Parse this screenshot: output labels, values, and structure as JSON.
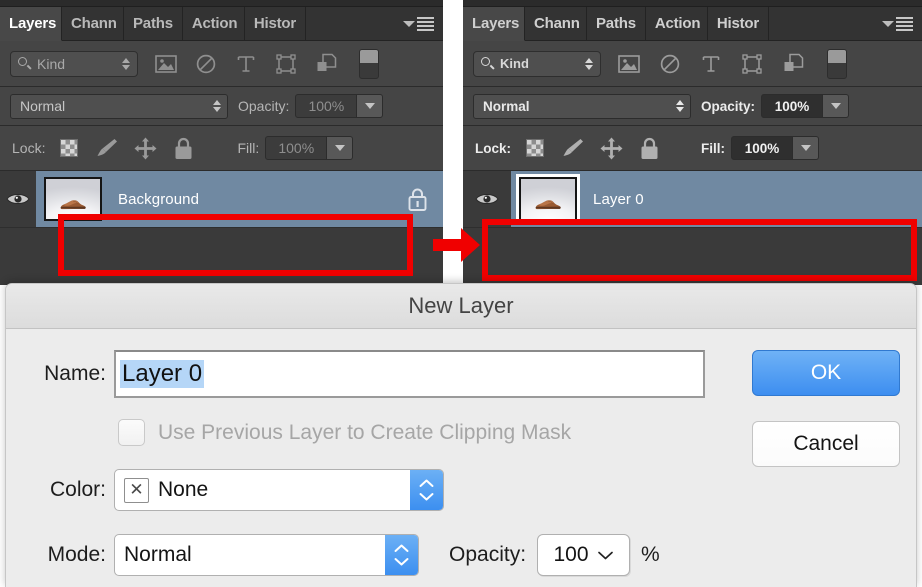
{
  "panels": {
    "before": {
      "id": "before-panel",
      "tabs": [
        {
          "label": "Layers",
          "active": true
        },
        {
          "label": "Chann",
          "active": false
        },
        {
          "label": "Paths",
          "active": false
        },
        {
          "label": "Action",
          "active": false
        },
        {
          "label": "Histor",
          "active": false
        }
      ],
      "menu_icon": "panel-menu-icon",
      "filter": {
        "kind_label": "Kind",
        "search_icon": "search-icon",
        "icons": [
          "image-filter-icon",
          "adjustment-filter-icon",
          "type-filter-icon",
          "shape-filter-icon",
          "smart-object-filter-icon",
          "filter-toggle-switch"
        ]
      },
      "blend": {
        "mode": "Normal",
        "opacity_label": "Opacity:",
        "opacity_value": "100%"
      },
      "lock": {
        "label": "Lock:",
        "icons": [
          "lock-transparent-pixels-icon",
          "lock-image-pixels-icon",
          "lock-position-icon",
          "lock-all-icon"
        ],
        "fill_label": "Fill:",
        "fill_value": "100%"
      },
      "layer": {
        "name": "Background",
        "visible": true,
        "locked": true,
        "thumbnail": "shoe-thumbnail",
        "selected": true
      }
    },
    "after": {
      "id": "after-panel",
      "tabs": [
        {
          "label": "Layers",
          "active": true
        },
        {
          "label": "Chann",
          "active": false
        },
        {
          "label": "Paths",
          "active": false
        },
        {
          "label": "Action",
          "active": false
        },
        {
          "label": "Histor",
          "active": false
        }
      ],
      "menu_icon": "panel-menu-icon",
      "filter": {
        "kind_label": "Kind",
        "search_icon": "search-icon",
        "icons": [
          "image-filter-icon",
          "adjustment-filter-icon",
          "type-filter-icon",
          "shape-filter-icon",
          "smart-object-filter-icon",
          "filter-toggle-switch"
        ]
      },
      "blend": {
        "mode": "Normal",
        "opacity_label": "Opacity:",
        "opacity_value": "100%"
      },
      "lock": {
        "label": "Lock:",
        "icons": [
          "lock-transparent-pixels-icon",
          "lock-image-pixels-icon",
          "lock-position-icon",
          "lock-all-icon"
        ],
        "fill_label": "Fill:",
        "fill_value": "100%"
      },
      "layer": {
        "name": "Layer 0",
        "visible": true,
        "locked": false,
        "thumbnail": "shoe-thumbnail",
        "selected": true
      }
    }
  },
  "annotation": {
    "arrow_icon": "red-right-arrow",
    "highlight_color": "#f00000"
  },
  "dialog": {
    "title": "New Layer",
    "name_label": "Name:",
    "name_value": "Layer 0",
    "clipping_label": "Use Previous Layer to Create Clipping Mask",
    "clipping_checked": false,
    "color_label": "Color:",
    "color_value": "None",
    "color_swatch_glyph": "✕",
    "mode_label": "Mode:",
    "mode_value": "Normal",
    "opacity_label": "Opacity:",
    "opacity_value": "100",
    "percent_symbol": "%",
    "ok_label": "OK",
    "cancel_label": "Cancel",
    "accent_color": "#3d8ef0"
  }
}
